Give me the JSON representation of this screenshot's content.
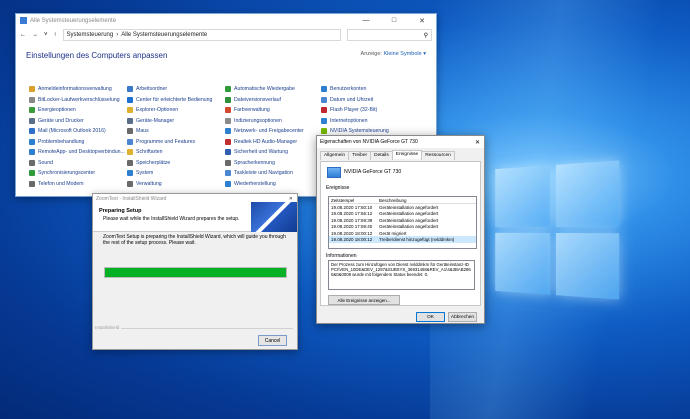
{
  "control_panel": {
    "window_title": "Alle Systemsteuerungselemente",
    "breadcrumb": [
      "Systemsteuerung",
      "Alle Systemsteuerungselemente"
    ],
    "heading": "Einstellungen des Computers anpassen",
    "view_by_label": "Anzeige:",
    "view_by_value": "Kleine Symbole",
    "items": [
      {
        "label": "Anmeldeinformationsverwaltung",
        "color": "#d9a12b"
      },
      {
        "label": "Arbeitsordner",
        "color": "#3a78c9"
      },
      {
        "label": "Automatische Wiedergabe",
        "color": "#2f9b3b"
      },
      {
        "label": "Benutzerkonten",
        "color": "#2f7fd1"
      },
      {
        "label": "BitLocker-Laufwerkverschlüsselung",
        "color": "#888888"
      },
      {
        "label": "Center für erleichterte Bedienung",
        "color": "#1f6fd1"
      },
      {
        "label": "Dateiversionsverlauf",
        "color": "#2f8f3a"
      },
      {
        "label": "Datum und Uhrzeit",
        "color": "#4a86d1"
      },
      {
        "label": "Energieoptionen",
        "color": "#3a9b3a"
      },
      {
        "label": "Explorer-Optionen",
        "color": "#e0b030"
      },
      {
        "label": "Farbverwaltung",
        "color": "#d14a2f"
      },
      {
        "label": "Flash Player (32-Bit)",
        "color": "#c0282d"
      },
      {
        "label": "Geräte und Drucker",
        "color": "#5a6e8a"
      },
      {
        "label": "Geräte-Manager",
        "color": "#5a6e8a"
      },
      {
        "label": "Indizierungsoptionen",
        "color": "#8a8a8a"
      },
      {
        "label": "Internetoptionen",
        "color": "#2f7fd1"
      },
      {
        "label": "Mail (Microsoft Outlook 2016)",
        "color": "#2f6fc9"
      },
      {
        "label": "Maus",
        "color": "#6a6a6a"
      },
      {
        "label": "Netzwerk- und Freigabecenter",
        "color": "#2f7fd1"
      },
      {
        "label": "NVIDIA Systemsteuerung",
        "color": "#76b900"
      },
      {
        "label": "Problembehandlung",
        "color": "#2f7fd1"
      },
      {
        "label": "Programme und Features",
        "color": "#4a86d1"
      },
      {
        "label": "Realtek HD Audio-Manager",
        "color": "#c03030"
      },
      {
        "label": "",
        "color": ""
      },
      {
        "label": "RemoteApp- und Desktopverbindun...",
        "color": "#2f7fd1"
      },
      {
        "label": "Schriftarten",
        "color": "#e0b030"
      },
      {
        "label": "Sicherheit und Wartung",
        "color": "#2f5fb0"
      },
      {
        "label": "",
        "color": ""
      },
      {
        "label": "Sound",
        "color": "#6a6a6a"
      },
      {
        "label": "Speicherplätze",
        "color": "#6a6a6a"
      },
      {
        "label": "Spracherkennung",
        "color": "#6a6a6a"
      },
      {
        "label": "",
        "color": ""
      },
      {
        "label": "Synchronisierungscenter",
        "color": "#2f9b3b"
      },
      {
        "label": "System",
        "color": "#2f7fd1"
      },
      {
        "label": "Taskleiste und Navigation",
        "color": "#4a86d1"
      },
      {
        "label": "",
        "color": ""
      },
      {
        "label": "Telefon und Modem",
        "color": "#6a6a6a"
      },
      {
        "label": "Verwaltung",
        "color": "#6a6a6a"
      },
      {
        "label": "Wiederherstellung",
        "color": "#2f7fd1"
      },
      {
        "label": "",
        "color": ""
      }
    ]
  },
  "installshield": {
    "title": "ZoomText - InstallShield Wizard",
    "header_title": "Preparing Setup",
    "header_sub": "Please wait while the InstallShield Wizard prepares the setup.",
    "message": "ZoomText Setup is preparing the InstallShield Wizard, which will guide you through the rest of the setup process. Please wait.",
    "progress": 1.0,
    "brand": "InstallShield",
    "cancel": "Cancel"
  },
  "properties": {
    "title": "Eigenschaften von NVIDIA GeForce GT 730",
    "tabs": [
      "Allgemein",
      "Treiber",
      "Details",
      "Ereignisse",
      "Ressourcen"
    ],
    "active_tab": 3,
    "device_name": "NVIDIA GeForce GT 730",
    "events_label": "Ereignisse",
    "col_time": "Zeitstempel",
    "col_desc": "Beschreibung",
    "events": [
      {
        "time": "19.08.2020 17:50:10",
        "desc": "Geräteinstallation angefordert"
      },
      {
        "time": "19.08.2020 17:56:12",
        "desc": "Geräteinstallation angefordert"
      },
      {
        "time": "19.08.2020 17:59:39",
        "desc": "Geräteinstallation angefordert"
      },
      {
        "time": "19.08.2020 17:59:40",
        "desc": "Geräteinstallation angefordert"
      },
      {
        "time": "19.08.2020 18:00:12",
        "desc": "Gerät migriert"
      },
      {
        "time": "19.08.2020 18:00:12",
        "desc": "Treiberdienst hinzugefügt (nvlddmkm)"
      }
    ],
    "info_label": "Informationen",
    "info_text": "Der Prozess zum Hinzufügen von Dienst nvlddmkm für Geräteinstanz-ID PCI\\VEN_10DE&DEV_1287&SUBSYS_36931458&REV_A1\\4&3BAB286 0&0&0008 wurde mit folgendem Status beendet: 0.",
    "all_events": "Alle Ereignisse anzeigen...",
    "ok": "OK",
    "cancel": "Abbrechen"
  }
}
